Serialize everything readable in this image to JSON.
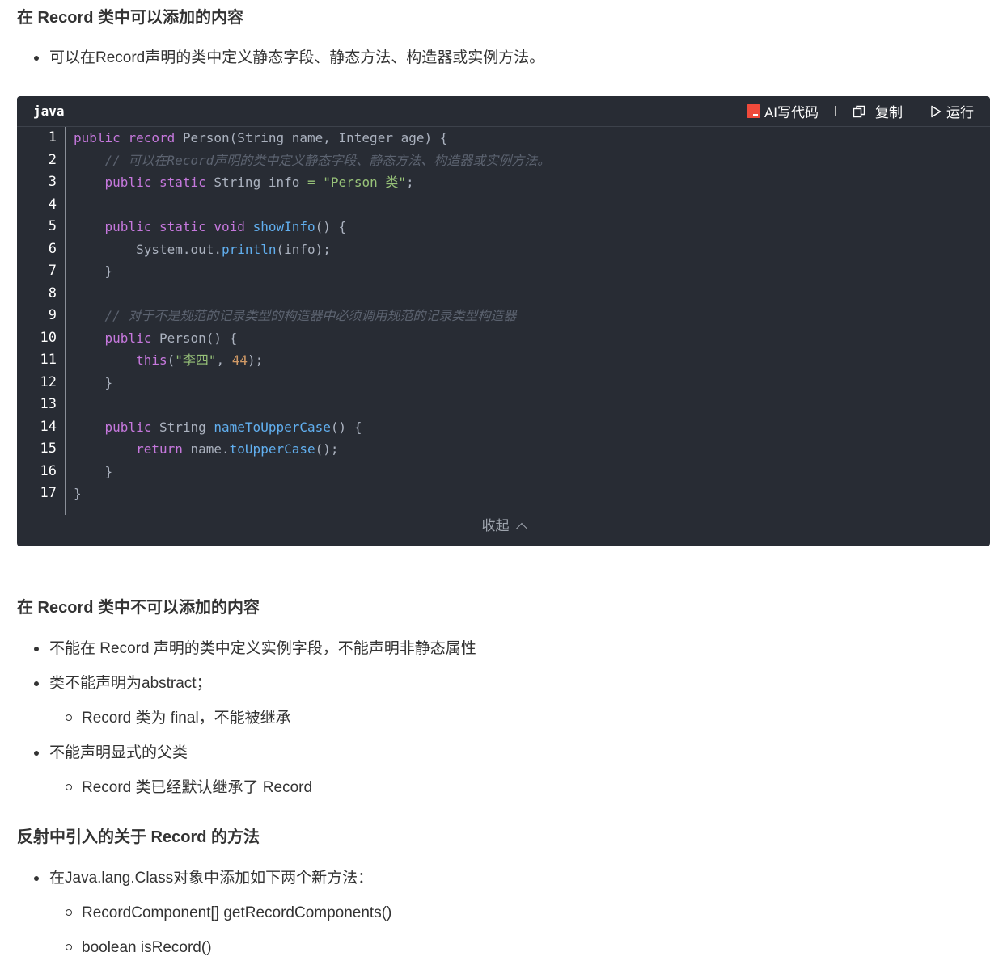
{
  "section1": {
    "heading": "在 Record 类中可以添加的内容",
    "bullets": [
      "可以在Record声明的类中定义静态字段、静态方法、构造器或实例方法。"
    ]
  },
  "code_block": {
    "language": "java",
    "ai_label": "AI写代码",
    "copy_label": "复制",
    "run_label": "运行",
    "collapse_label": "收起",
    "line_numbers": [
      "1",
      "2",
      "3",
      "4",
      "5",
      "6",
      "7",
      "8",
      "9",
      "10",
      "11",
      "12",
      "13",
      "14",
      "15",
      "16",
      "17"
    ],
    "lines": [
      "public record Person(String name, Integer age) {",
      "    // 可以在Record声明的类中定义静态字段、静态方法、构造器或实例方法。",
      "    public static String info = \"Person 类\";",
      "",
      "    public static void showInfo() {",
      "        System.out.println(info);",
      "    }",
      "",
      "    // 对于不是规范的记录类型的构造器中必须调用规范的记录类型构造器",
      "    public Person() {",
      "        this(\"李四\", 44);",
      "    }",
      "",
      "    public String nameToUpperCase() {",
      "        return name.toUpperCase();",
      "    }",
      "}"
    ],
    "colors": {
      "background": "#282c34",
      "keyword": "#c678dd",
      "function": "#61afef",
      "string": "#98c379",
      "number": "#d19a66",
      "comment": "#5c6370",
      "ai_icon": "#f04a3b"
    }
  },
  "section2": {
    "heading": "在 Record 类中不可以添加的内容",
    "items": [
      {
        "level": 1,
        "text": "不能在 Record 声明的类中定义实例字段，不能声明非静态属性"
      },
      {
        "level": 1,
        "text": "类不能声明为abstract；"
      },
      {
        "level": 2,
        "text": "Record 类为 final，不能被继承"
      },
      {
        "level": 1,
        "text": "不能声明显式的父类"
      },
      {
        "level": 2,
        "text": "Record 类已经默认继承了 Record"
      }
    ]
  },
  "section3": {
    "heading": "反射中引入的关于 Record 的方法",
    "items": [
      {
        "level": 1,
        "text": "在Java.lang.Class对象中添加如下两个新方法："
      },
      {
        "level": 2,
        "text": "RecordComponent[] getRecordComponents()"
      },
      {
        "level": 2,
        "text": "boolean isRecord()"
      }
    ]
  }
}
